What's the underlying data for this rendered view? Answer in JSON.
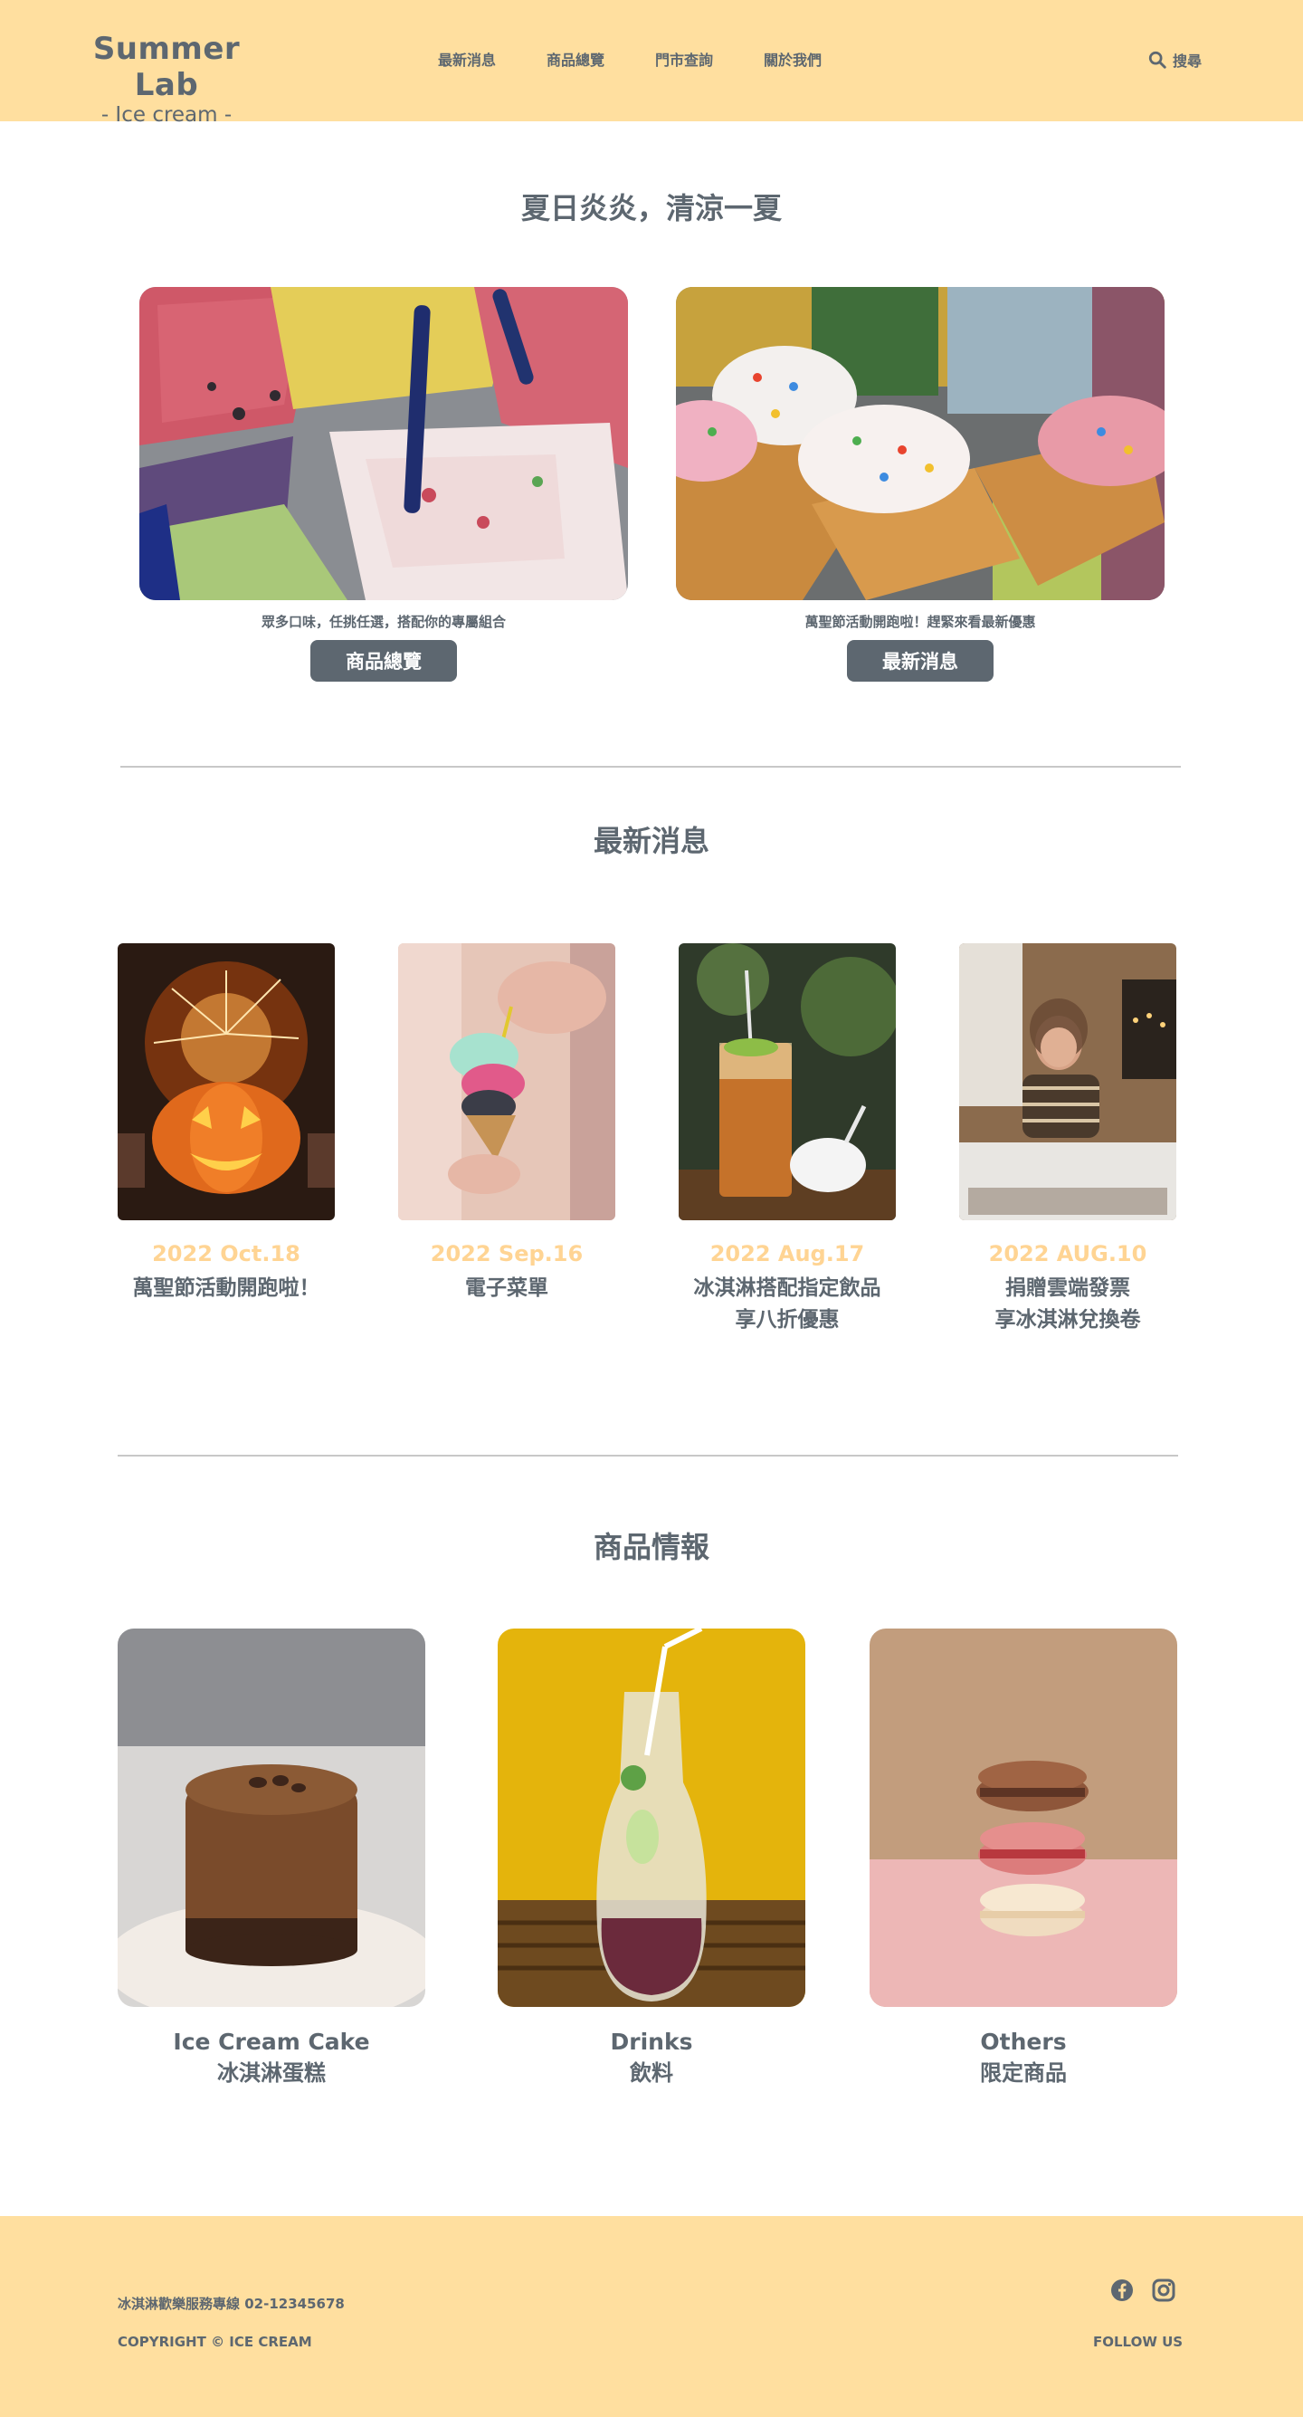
{
  "header": {
    "logo_title": "Summer Lab",
    "logo_subtitle": "- Ice cream -",
    "nav": [
      "最新消息",
      "商品總覽",
      "門市查詢",
      "關於我們"
    ],
    "search_label": "搜尋",
    "background": "#ffdf9f"
  },
  "hero": {
    "title": "夏日炎炎，清涼一夏",
    "cards": [
      {
        "image": "gelato-display-photo",
        "caption": "眾多口味，任挑任選，搭配你的專屬組合",
        "button": "商品總覽"
      },
      {
        "image": "sprinkle-cones-photo",
        "caption": "萬聖節活動開跑啦！趕緊來看最新優惠",
        "button": "最新消息"
      }
    ]
  },
  "news": {
    "title": "最新消息",
    "items": [
      {
        "image": "pumpkin-sparkler-photo",
        "date": "2022 Oct.18",
        "title": "萬聖節活動開跑啦！"
      },
      {
        "image": "ice-cream-cone-hand-photo",
        "date": "2022 Sep.16",
        "title": "電子菜單"
      },
      {
        "image": "iced-tea-drink-photo",
        "date": "2022 Aug.17",
        "title": "冰淇淋搭配指定飲品\n享八折優惠"
      },
      {
        "image": "woman-eating-ice-cream-photo",
        "date": "2022 AUG.10",
        "title": "捐贈雲端發票\n享冰淇淋兌換卷"
      }
    ]
  },
  "products": {
    "title": "商品情報",
    "items": [
      {
        "image": "chocolate-cake-photo",
        "name_en": "Ice Cream Cake",
        "name_zh": "冰淇淋蛋糕"
      },
      {
        "image": "fruit-drink-bottle-photo",
        "name_en": "Drinks",
        "name_zh": "飲料"
      },
      {
        "image": "macaron-stack-photo",
        "name_en": "Others",
        "name_zh": "限定商品"
      }
    ]
  },
  "footer": {
    "service_line": "冰淇淋歡樂服務專線 02-12345678",
    "copyright": "COPYRIGHT ©  ICE CREAM",
    "follow": "FOLLOW US",
    "social_icons": [
      "facebook-icon",
      "instagram-icon"
    ]
  },
  "colors": {
    "accent": "#ffdf9f",
    "text": "#5d6770",
    "date": "#ffd493",
    "button": "#5d6770"
  }
}
